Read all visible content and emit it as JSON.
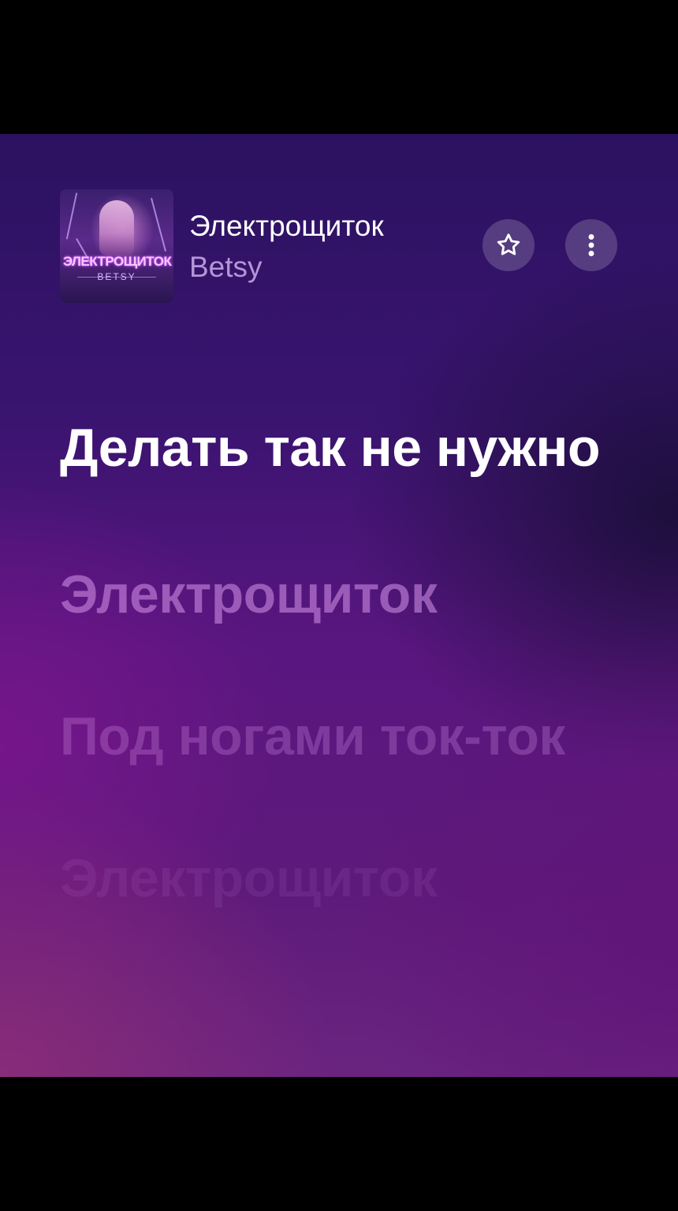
{
  "player": {
    "track_title": "Электрощиток",
    "artist": "Betsy",
    "cover": {
      "title_text": "ЭЛЕКТРОЩИТОК",
      "artist_text": "BETSY"
    },
    "favorite_icon": "star-outline-icon",
    "more_icon": "vertical-dots-icon"
  },
  "lyrics": {
    "current": "Делать так не нужно",
    "next": "Электрощиток",
    "later": "Под ногами ток-ток",
    "far": "Электрощиток"
  },
  "colors": {
    "accent_text": "#b695d8",
    "button_bg": "rgba(255,255,255,0.18)"
  }
}
